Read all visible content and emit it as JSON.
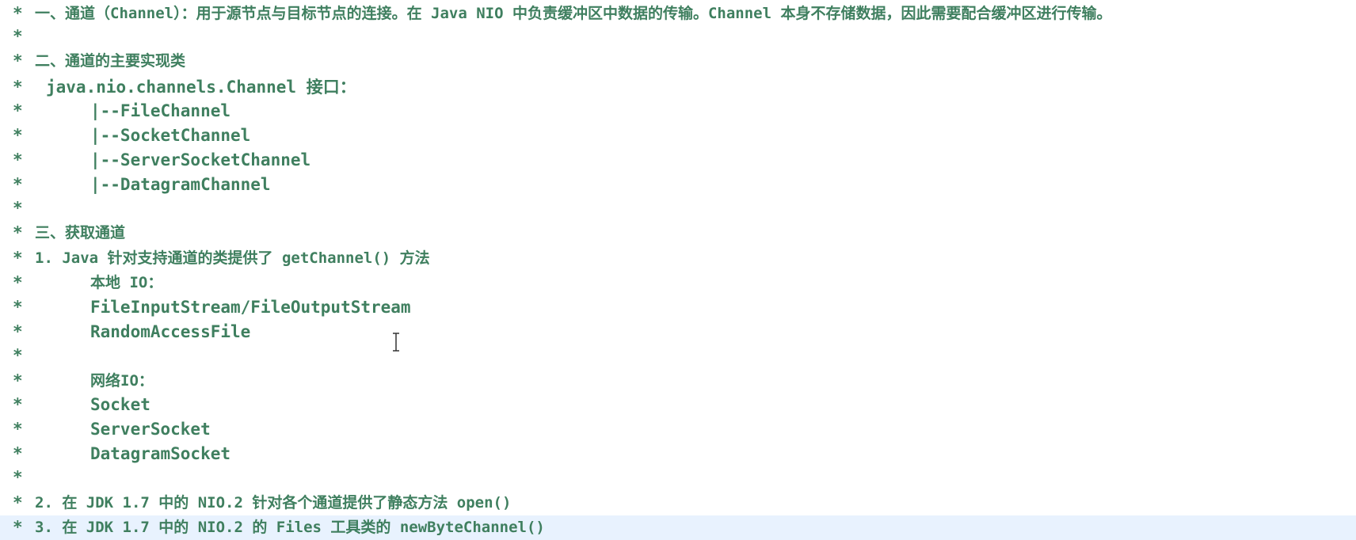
{
  "editor": {
    "lines": [
      {
        "star": "*",
        "text": "一、通道（Channel）：用于源节点与目标节点的连接。在 Java NIO 中负责缓冲区中数据的传输。Channel 本身不存储数据，因此需要配合缓冲区进行传输。"
      },
      {
        "star": "*",
        "text": ""
      },
      {
        "star": "*",
        "text": "二、通道的主要实现类"
      },
      {
        "star": "*",
        "text": "java.nio.channels.Channel 接口："
      },
      {
        "star": "*",
        "text": "|--FileChannel"
      },
      {
        "star": "*",
        "text": "|--SocketChannel"
      },
      {
        "star": "*",
        "text": "|--ServerSocketChannel"
      },
      {
        "star": "*",
        "text": "|--DatagramChannel"
      },
      {
        "star": "*",
        "text": ""
      },
      {
        "star": "*",
        "text": "三、获取通道"
      },
      {
        "star": "*",
        "text": "1. Java 针对支持通道的类提供了 getChannel() 方法"
      },
      {
        "star": "*",
        "text": "本地 IO："
      },
      {
        "star": "*",
        "text": "FileInputStream/FileOutputStream"
      },
      {
        "star": "*",
        "text": "RandomAccessFile"
      },
      {
        "star": "*",
        "text": ""
      },
      {
        "star": "*",
        "text": "网络IO："
      },
      {
        "star": "*",
        "text": "Socket"
      },
      {
        "star": "*",
        "text": "ServerSocket"
      },
      {
        "star": "*",
        "text": "DatagramSocket"
      },
      {
        "star": "*",
        "text": ""
      },
      {
        "star": "*",
        "text": "2. 在 JDK 1.7 中的 NIO.2 针对各个通道提供了静态方法 open()"
      },
      {
        "star": "*",
        "text": "3. 在 JDK 1.7 中的 NIO.2 的 Files 工具类的 newByteChannel()"
      }
    ]
  }
}
